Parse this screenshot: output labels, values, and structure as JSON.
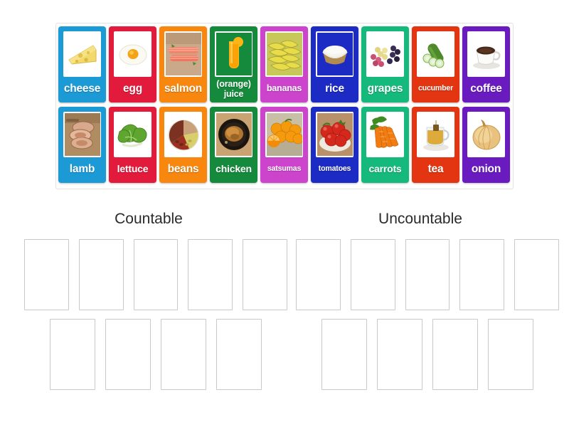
{
  "activity": {
    "type": "group-sort",
    "tray_rows": [
      [
        {
          "label": "cheese",
          "color": "#1C9AD6",
          "icon": "cheese-wedge-icon",
          "label_size": "s16"
        },
        {
          "label": "egg",
          "color": "#E21A3C",
          "icon": "fried-egg-icon",
          "label_size": "s16"
        },
        {
          "label": "salmon",
          "color": "#F7870F",
          "icon": "salmon-fillet-icon",
          "label_size": "s16"
        },
        {
          "label": "(orange) juice",
          "color": "#158A3C",
          "icon": "juice-glass-icon",
          "label_size": "two-line",
          "lines": [
            "(orange)",
            "juice"
          ]
        },
        {
          "label": "bananas",
          "color": "#C councils",
          "icon": "bananas-icon",
          "label_size": "s13"
        },
        {
          "label": "rice",
          "color": "#1C2BC4",
          "icon": "rice-bowl-icon",
          "label_size": "s16"
        },
        {
          "label": "grapes",
          "color": "#16B97C",
          "icon": "grapes-icon",
          "label_size": "s16"
        },
        {
          "label": "cucumber",
          "color": "#E33511",
          "icon": "cucumber-icon",
          "label_size": "s11"
        },
        {
          "label": "coffee",
          "color": "#6A1BBF",
          "icon": "coffee-cup-icon",
          "label_size": "s16"
        }
      ],
      [
        {
          "label": "lamb",
          "color": "#1C9AD6",
          "icon": "lamb-meat-icon",
          "label_size": "s16"
        },
        {
          "label": "lettuce",
          "color": "#E21A3C",
          "icon": "lettuce-icon",
          "label_size": "s14"
        },
        {
          "label": "beans",
          "color": "#F7870F",
          "icon": "beans-plate-icon",
          "label_size": "s16"
        },
        {
          "label": "chicken",
          "color": "#158A3C",
          "icon": "roast-chicken-icon",
          "label_size": "s14"
        },
        {
          "label": "satsumas",
          "color": "#C councils",
          "icon": "satsumas-icon",
          "label_size": "s11"
        },
        {
          "label": "tomatoes",
          "color": "#1C2BC4",
          "icon": "tomatoes-icon",
          "label_size": "s11"
        },
        {
          "label": "carrots",
          "color": "#16B97C",
          "icon": "carrots-icon",
          "label_size": "s14"
        },
        {
          "label": "tea",
          "color": "#E33511",
          "icon": "tea-cup-icon",
          "label_size": "s16"
        },
        {
          "label": "onion",
          "color": "#6A1BBF",
          "icon": "onion-icon",
          "label_size": "s16"
        }
      ]
    ],
    "groups": [
      {
        "title": "Countable",
        "slot_rows": [
          5,
          4
        ]
      },
      {
        "title": "Uncountable",
        "slot_rows": [
          5,
          4
        ]
      }
    ]
  },
  "colors": {
    "tray_border": "#e2e2e2",
    "slot_border": "#c9c9c9",
    "heading_text": "#2a2a2a",
    "background": "#ffffff",
    "card_blue": "#1C9AD6",
    "card_red": "#E21A3C",
    "card_orange": "#F7870F",
    "card_green": "#158A3C",
    "card_magenta": "#CC44CC",
    "card_navy": "#1C2BC4",
    "card_emerald": "#16B97C",
    "card_vermilion": "#E33511",
    "card_purple": "#6A1BBF"
  }
}
